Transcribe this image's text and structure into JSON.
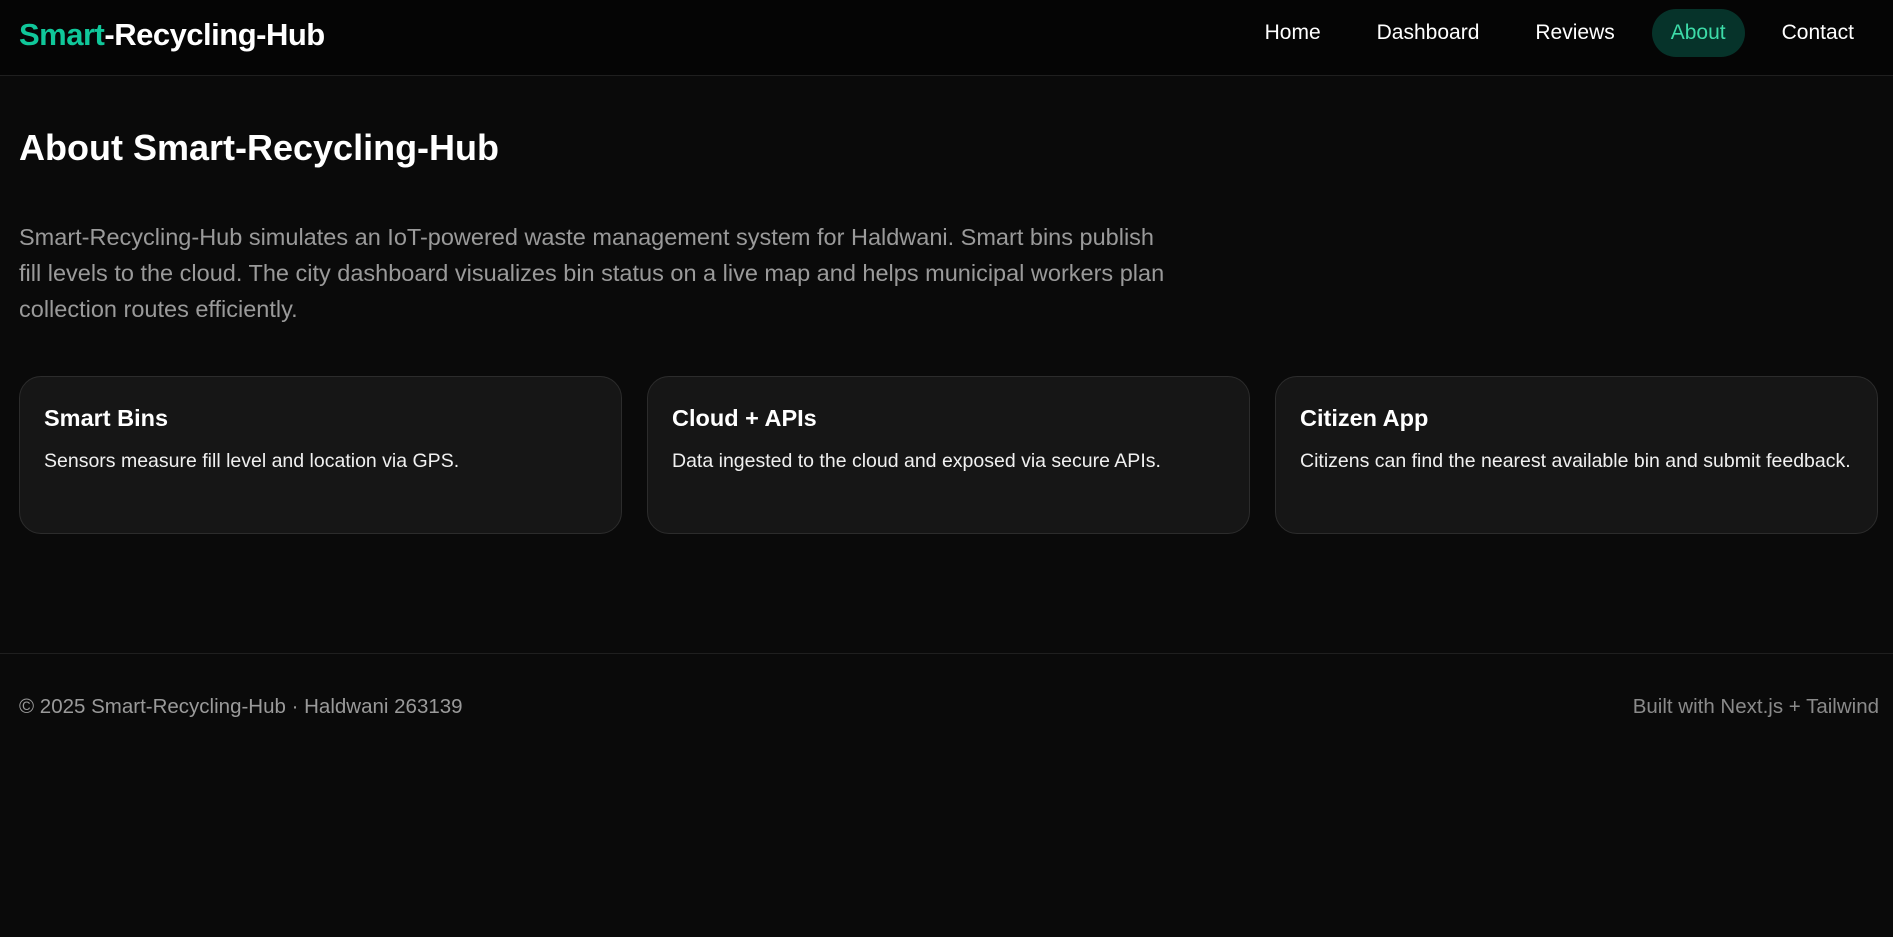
{
  "navbar": {
    "logo_accent": "Smart",
    "logo_rest": "-Recycling-Hub",
    "links": [
      {
        "label": "Home",
        "active": false
      },
      {
        "label": "Dashboard",
        "active": false
      },
      {
        "label": "Reviews",
        "active": false
      },
      {
        "label": "About",
        "active": true
      },
      {
        "label": "Contact",
        "active": false
      }
    ]
  },
  "main": {
    "title": "About Smart-Recycling-Hub",
    "intro": "Smart-Recycling-Hub simulates an IoT-powered waste management system for Haldwani. Smart bins publish fill levels to the cloud. The city dashboard visualizes bin status on a live map and helps municipal workers plan collection routes efficiently.",
    "cards": [
      {
        "title": "Smart Bins",
        "text": "Sensors measure fill level and location via GPS."
      },
      {
        "title": "Cloud + APIs",
        "text": "Data ingested to the cloud and exposed via secure APIs."
      },
      {
        "title": "Citizen App",
        "text": "Citizens can find the nearest available bin and submit feedback."
      }
    ]
  },
  "footer": {
    "copyright": "© 2025 Smart-Recycling-Hub · Haldwani 263139",
    "built_with": "Built with Next.js + Tailwind"
  },
  "colors": {
    "background": "#0a0a0a",
    "accent": "#10c79a",
    "active_pill_bg": "#06332a",
    "card_bg": "#161616"
  }
}
